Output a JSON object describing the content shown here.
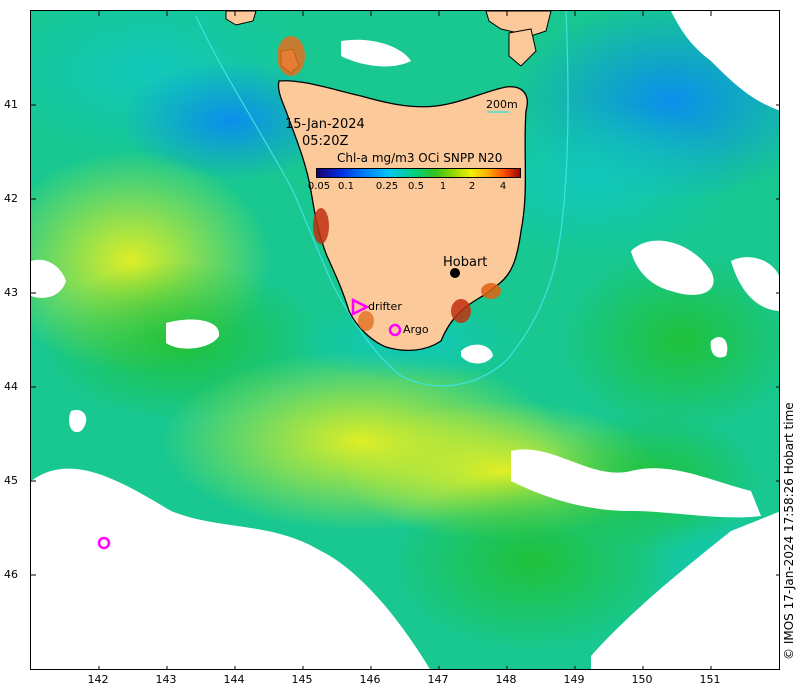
{
  "map": {
    "date": "15-Jan-2024",
    "time": "05:20Z",
    "colorbar_title": "Chl-a mg/m3 OCi SNPP N20",
    "colorbar_ticks": [
      "0.05",
      "0.1",
      "0.25",
      "0.5",
      "1",
      "2",
      "4"
    ],
    "contour_label": "200m",
    "places": {
      "hobart": "Hobart"
    },
    "markers": {
      "drifter": "drifter",
      "argo": "Argo"
    },
    "credit": "© IMOS 17-Jan-2024 17:58:26 Hobart time",
    "lat_ticks": [
      "41",
      "42",
      "43",
      "44",
      "45",
      "46"
    ],
    "lon_ticks": [
      "142",
      "143",
      "144",
      "145",
      "146",
      "147",
      "148",
      "149",
      "150",
      "151"
    ],
    "colors": {
      "land": "#fcc99b",
      "ocean_low": "#00c8f0",
      "ocean_mid": "#30c020",
      "ocean_high": "#f0f000",
      "marker": "#ff00ff",
      "contour": "#40e0e0"
    }
  }
}
